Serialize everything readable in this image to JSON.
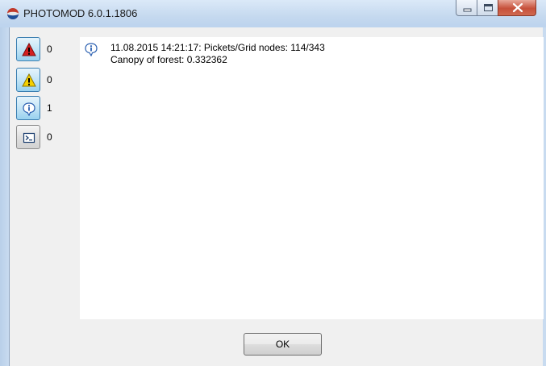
{
  "window": {
    "title": "PHOTOMOD 6.0.1.1806",
    "app_icon": "photomod-logo-icon",
    "controls": [
      "minimize-icon",
      "maximize-icon",
      "close-icon"
    ]
  },
  "filters": [
    {
      "icon": "error-icon",
      "count": "0",
      "active": true
    },
    {
      "icon": "warning-icon",
      "count": "0",
      "active": true
    },
    {
      "icon": "info-icon",
      "count": "1",
      "active": true
    },
    {
      "icon": "console-icon",
      "count": "0",
      "active": false
    }
  ],
  "log": {
    "entries": [
      {
        "icon": "info-icon",
        "line1": "11.08.2015 14:21:17: Pickets/Grid nodes: 114/343",
        "line2": "Canopy of forest: 0.332362"
      }
    ]
  },
  "buttons": {
    "ok_label": "OK"
  },
  "colors": {
    "error": "#d42020",
    "warning": "#f5d000",
    "info": "#2a5fb0"
  }
}
